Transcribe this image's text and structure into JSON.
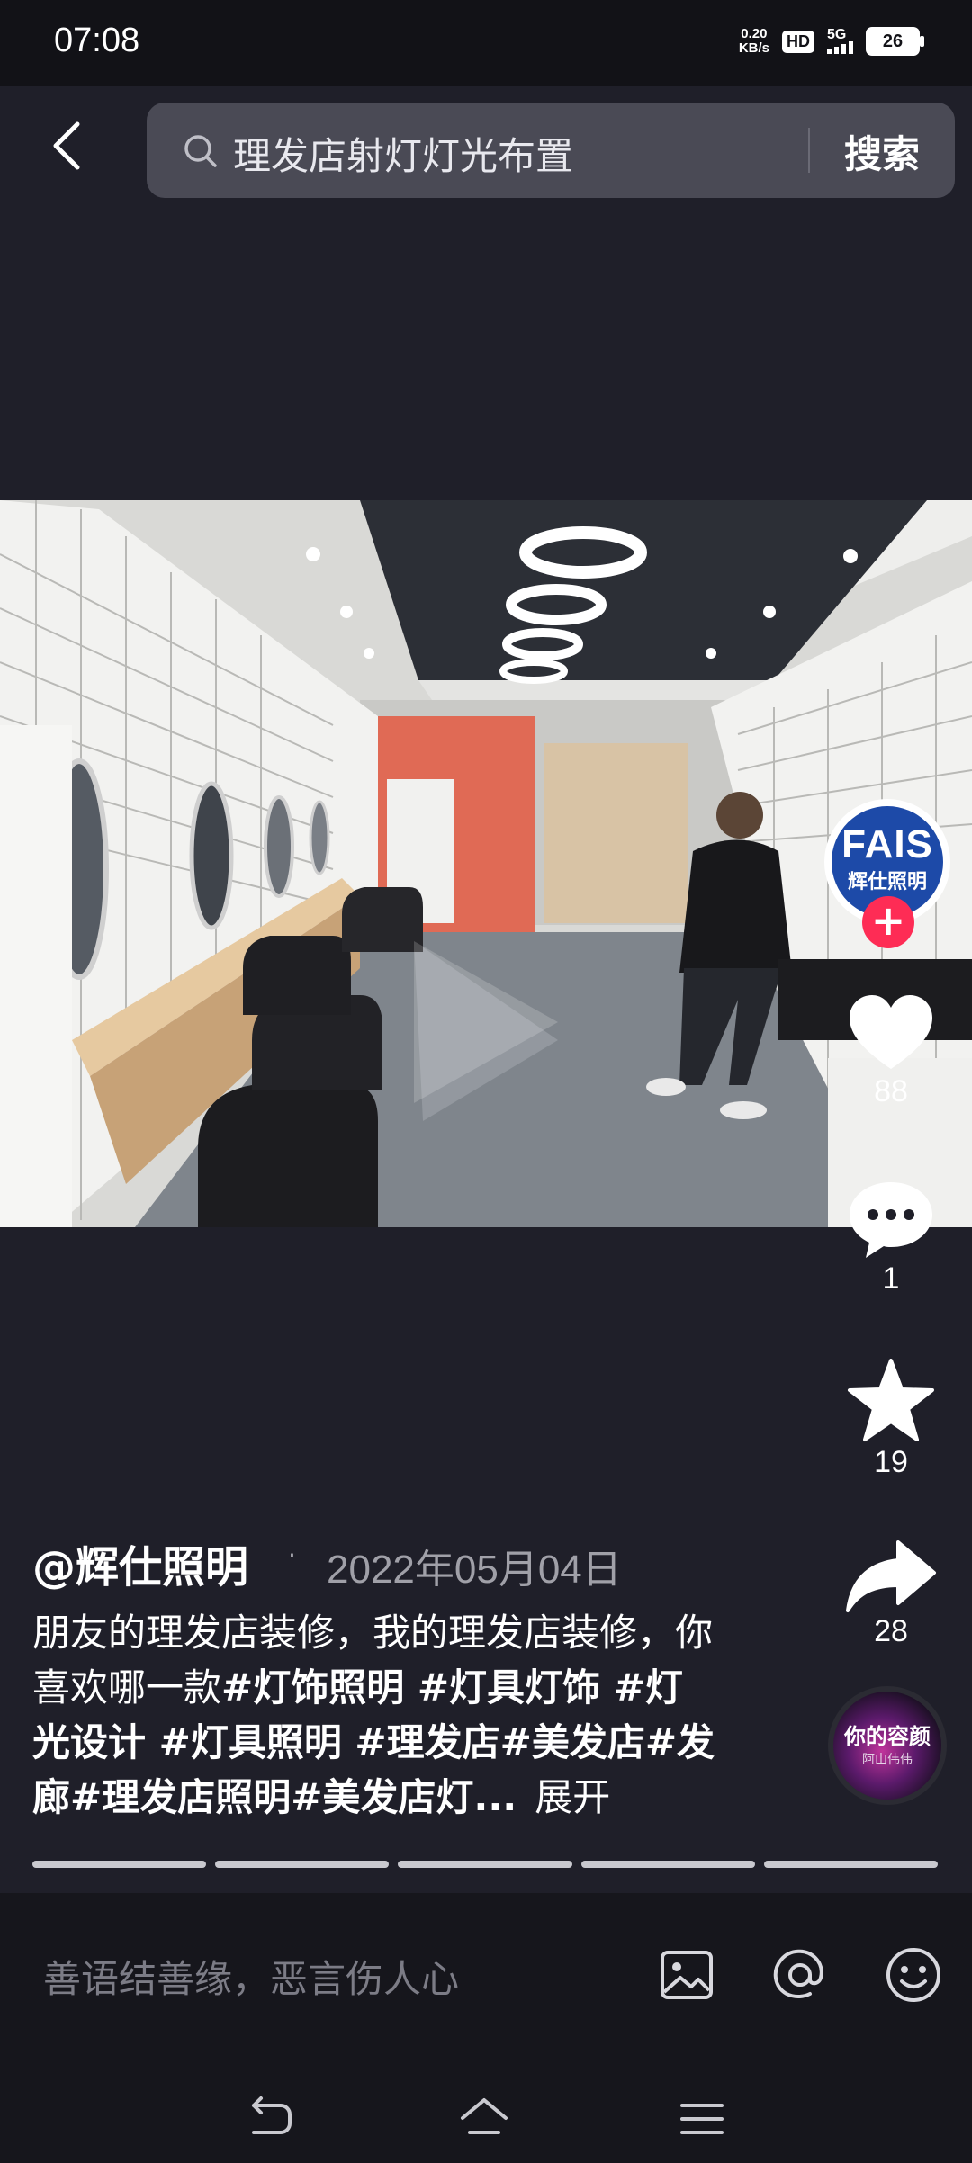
{
  "status": {
    "time": "07:08",
    "net_speed_value": "0.20",
    "net_speed_unit": "KB/s",
    "hd": "HD",
    "network": "5G",
    "battery": "26"
  },
  "search": {
    "query": "理发店射灯灯光布置",
    "button": "搜索"
  },
  "brand": {
    "logo_text": "FAIS",
    "logo_sub": "辉仕照明"
  },
  "actions": {
    "likes": "88",
    "comments": "1",
    "favorites": "19",
    "shares": "28"
  },
  "post": {
    "author": "@辉仕照明",
    "dot": "·",
    "date": "2022年05月04日",
    "text_plain": "朋友的理发店装修，我的理发店装修，你喜欢哪一款",
    "text_tags": "#灯饰照明 #灯具灯饰 #灯光设计 #灯具照明 #理发店#美发店#发廊#理发店照明#美发店灯...",
    "expand": "展开"
  },
  "music": {
    "title": "你的容颜",
    "subtitle": "阿山伟伟"
  },
  "comment": {
    "placeholder": "善语结善缘，恶言伤人心"
  },
  "colors": {
    "background": "#1f1f29",
    "accent": "#fe2c55",
    "brand_blue": "#1d4aa8"
  }
}
